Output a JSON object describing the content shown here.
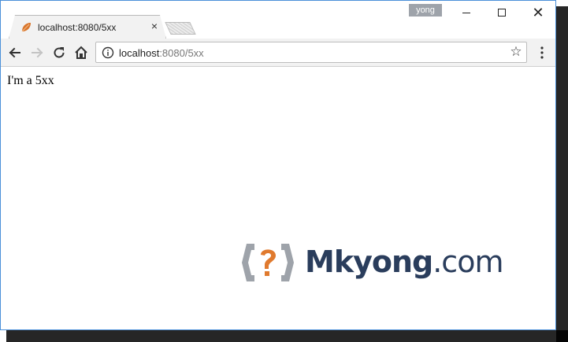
{
  "browser": {
    "tab": {
      "title": "localhost:8080/5xx",
      "close_glyph": "×"
    },
    "profile": {
      "name": "yong"
    },
    "window_controls": {
      "close_glyph": "✕"
    },
    "address_bar": {
      "host": "localhost",
      "path": ":8080/5xx"
    },
    "icons": {
      "back": "arrow-left-icon",
      "forward": "arrow-right-icon",
      "reload": "reload-icon",
      "home": "home-icon",
      "info": "info-icon",
      "bookmark": "star-icon",
      "menu": "kebab-menu-icon",
      "favicon": "spring-leaf-icon"
    }
  },
  "page": {
    "text": "I'm a 5xx"
  },
  "watermark": {
    "brand": "Mkyong",
    "tld": ".com"
  },
  "colors": {
    "window_border": "#4a90d9",
    "toolbar_bg": "#f2f2f2",
    "watermark_blue": "#2a3d5c",
    "watermark_orange": "#e07a2e",
    "watermark_gray": "#9ea3aa"
  }
}
